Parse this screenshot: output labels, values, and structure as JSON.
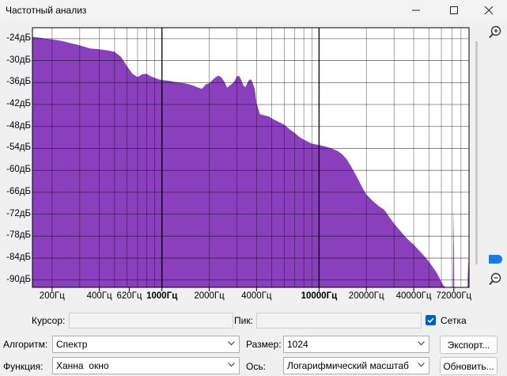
{
  "window": {
    "title": "Частотный анализ"
  },
  "chart_data": {
    "type": "area",
    "color": "#8a3fbd",
    "xscale": "log",
    "xlim": [
      150,
      90000
    ],
    "ylim": [
      -92,
      -21
    ],
    "x": [
      150,
      170,
      200,
      230,
      260,
      300,
      350,
      400,
      450,
      500,
      550,
      600,
      650,
      700,
      750,
      800,
      850,
      900,
      950,
      1000,
      1100,
      1200,
      1300,
      1400,
      1500,
      1600,
      1700,
      1800,
      1900,
      2000,
      2100,
      2200,
      2300,
      2400,
      2500,
      2600,
      2700,
      2800,
      2900,
      3000,
      3100,
      3200,
      3300,
      3400,
      3500,
      3600,
      3700,
      3800,
      3900,
      4000,
      4200,
      4400,
      4600,
      4800,
      5000,
      5500,
      6000,
      6500,
      7000,
      7500,
      8000,
      8500,
      9000,
      10000,
      11000,
      12000,
      13000,
      14000,
      15000,
      16000,
      17000,
      18000,
      19000,
      20000,
      22000,
      24000,
      26000,
      28000,
      30000,
      32000,
      34000,
      36000,
      38000,
      40000,
      42000,
      44000,
      46000,
      48000,
      50000,
      52000,
      54000,
      56000,
      58000,
      60000,
      62000,
      64000,
      66000,
      68000,
      70000,
      71000,
      72000,
      72500,
      73000,
      74000,
      80000,
      85000,
      88000,
      89000,
      90000
    ],
    "values": [
      -23.5,
      -23.8,
      -24.2,
      -24.6,
      -25.2,
      -25.8,
      -26.7,
      -26.9,
      -27.2,
      -27.6,
      -29,
      -31.5,
      -33.6,
      -34.5,
      -33.7,
      -33.6,
      -34.3,
      -34.7,
      -35.1,
      -35.3,
      -35.5,
      -35.8,
      -36.0,
      -36.2,
      -36.5,
      -36.9,
      -37.4,
      -37.7,
      -36.5,
      -36.2,
      -35.3,
      -34.5,
      -34.1,
      -34.7,
      -35.8,
      -37.4,
      -36.8,
      -36.3,
      -35.6,
      -34.3,
      -34.2,
      -35.3,
      -36.8,
      -37.3,
      -36.1,
      -35.2,
      -35.2,
      -36.3,
      -37.8,
      -41.5,
      -44.6,
      -44.9,
      -45.1,
      -45.3,
      -45.8,
      -46.7,
      -47.5,
      -48.8,
      -49.8,
      -50.9,
      -51.6,
      -52.2,
      -52.7,
      -53.1,
      -53.5,
      -54.0,
      -54.6,
      -55.6,
      -57.0,
      -59.0,
      -61.0,
      -63.0,
      -65.0,
      -66.6,
      -68.4,
      -69.8,
      -70.8,
      -72.8,
      -74.5,
      -76.0,
      -77.3,
      -78.5,
      -79.5,
      -80.3,
      -81.3,
      -82.2,
      -83.2,
      -84.0,
      -85.0,
      -86.0,
      -87.0,
      -88.0,
      -89.2,
      -90.5,
      -91.5,
      -92,
      -92,
      -92,
      -92,
      -92,
      -69.8,
      -92,
      -92,
      -92,
      -92,
      -92,
      -92,
      -84.0,
      -92
    ],
    "yticks": [
      "-24дБ",
      "-30дБ",
      "-36дБ",
      "-42дБ",
      "-48дБ",
      "-54дБ",
      "-60дБ",
      "-66дБ",
      "-72дБ",
      "-78дБ",
      "-84дБ",
      "-90дБ"
    ],
    "xticks": [
      "200Гц",
      "400Гц",
      "620Гц",
      "1000Гц",
      "2000Гц",
      "4000Гц",
      "10000Гц",
      "20000Гц",
      "40000Гц",
      "72000Гц"
    ],
    "xtick_values": [
      200,
      400,
      620,
      1000,
      2000,
      4000,
      10000,
      20000,
      40000,
      72000
    ],
    "xtick_bold": [
      false,
      false,
      false,
      true,
      false,
      false,
      true,
      false,
      false,
      false
    ],
    "grid": true
  },
  "controls": {
    "cursor_label": "Курсор:",
    "peak_label": "Пик:",
    "grid_label": "Сетка",
    "grid_checked": true,
    "algorithm_label": "Алгоритм:",
    "algorithm_value": "Спектр",
    "size_label": "Размер:",
    "size_value": "1024",
    "export_button": "Экспорт...",
    "function_label": "Функция:",
    "function_value": "Ханна  окно",
    "axis_label": "Ось:",
    "axis_value": "Логарифмический масштаб",
    "refresh_button": "Обновить..."
  },
  "icons": {
    "minimize": "minimize-icon",
    "maximize": "maximize-icon",
    "close": "close-icon",
    "zoom_in": "zoom-in-icon",
    "zoom_out": "zoom-out-icon",
    "checkmark": "checkmark-icon",
    "chevron": "chevron-down-icon"
  }
}
